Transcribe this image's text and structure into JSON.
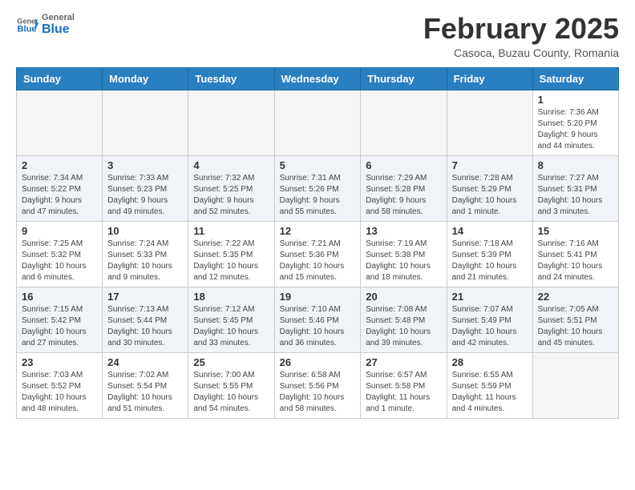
{
  "header": {
    "logo_line1": "General",
    "logo_line2": "Blue",
    "month_year": "February 2025",
    "location": "Casoca, Buzau County, Romania"
  },
  "weekdays": [
    "Sunday",
    "Monday",
    "Tuesday",
    "Wednesday",
    "Thursday",
    "Friday",
    "Saturday"
  ],
  "weeks": [
    [
      {
        "day": "",
        "info": ""
      },
      {
        "day": "",
        "info": ""
      },
      {
        "day": "",
        "info": ""
      },
      {
        "day": "",
        "info": ""
      },
      {
        "day": "",
        "info": ""
      },
      {
        "day": "",
        "info": ""
      },
      {
        "day": "1",
        "info": "Sunrise: 7:36 AM\nSunset: 5:20 PM\nDaylight: 9 hours\nand 44 minutes."
      }
    ],
    [
      {
        "day": "2",
        "info": "Sunrise: 7:34 AM\nSunset: 5:22 PM\nDaylight: 9 hours\nand 47 minutes."
      },
      {
        "day": "3",
        "info": "Sunrise: 7:33 AM\nSunset: 5:23 PM\nDaylight: 9 hours\nand 49 minutes."
      },
      {
        "day": "4",
        "info": "Sunrise: 7:32 AM\nSunset: 5:25 PM\nDaylight: 9 hours\nand 52 minutes."
      },
      {
        "day": "5",
        "info": "Sunrise: 7:31 AM\nSunset: 5:26 PM\nDaylight: 9 hours\nand 55 minutes."
      },
      {
        "day": "6",
        "info": "Sunrise: 7:29 AM\nSunset: 5:28 PM\nDaylight: 9 hours\nand 58 minutes."
      },
      {
        "day": "7",
        "info": "Sunrise: 7:28 AM\nSunset: 5:29 PM\nDaylight: 10 hours\nand 1 minute."
      },
      {
        "day": "8",
        "info": "Sunrise: 7:27 AM\nSunset: 5:31 PM\nDaylight: 10 hours\nand 3 minutes."
      }
    ],
    [
      {
        "day": "9",
        "info": "Sunrise: 7:25 AM\nSunset: 5:32 PM\nDaylight: 10 hours\nand 6 minutes."
      },
      {
        "day": "10",
        "info": "Sunrise: 7:24 AM\nSunset: 5:33 PM\nDaylight: 10 hours\nand 9 minutes."
      },
      {
        "day": "11",
        "info": "Sunrise: 7:22 AM\nSunset: 5:35 PM\nDaylight: 10 hours\nand 12 minutes."
      },
      {
        "day": "12",
        "info": "Sunrise: 7:21 AM\nSunset: 5:36 PM\nDaylight: 10 hours\nand 15 minutes."
      },
      {
        "day": "13",
        "info": "Sunrise: 7:19 AM\nSunset: 5:38 PM\nDaylight: 10 hours\nand 18 minutes."
      },
      {
        "day": "14",
        "info": "Sunrise: 7:18 AM\nSunset: 5:39 PM\nDaylight: 10 hours\nand 21 minutes."
      },
      {
        "day": "15",
        "info": "Sunrise: 7:16 AM\nSunset: 5:41 PM\nDaylight: 10 hours\nand 24 minutes."
      }
    ],
    [
      {
        "day": "16",
        "info": "Sunrise: 7:15 AM\nSunset: 5:42 PM\nDaylight: 10 hours\nand 27 minutes."
      },
      {
        "day": "17",
        "info": "Sunrise: 7:13 AM\nSunset: 5:44 PM\nDaylight: 10 hours\nand 30 minutes."
      },
      {
        "day": "18",
        "info": "Sunrise: 7:12 AM\nSunset: 5:45 PM\nDaylight: 10 hours\nand 33 minutes."
      },
      {
        "day": "19",
        "info": "Sunrise: 7:10 AM\nSunset: 5:46 PM\nDaylight: 10 hours\nand 36 minutes."
      },
      {
        "day": "20",
        "info": "Sunrise: 7:08 AM\nSunset: 5:48 PM\nDaylight: 10 hours\nand 39 minutes."
      },
      {
        "day": "21",
        "info": "Sunrise: 7:07 AM\nSunset: 5:49 PM\nDaylight: 10 hours\nand 42 minutes."
      },
      {
        "day": "22",
        "info": "Sunrise: 7:05 AM\nSunset: 5:51 PM\nDaylight: 10 hours\nand 45 minutes."
      }
    ],
    [
      {
        "day": "23",
        "info": "Sunrise: 7:03 AM\nSunset: 5:52 PM\nDaylight: 10 hours\nand 48 minutes."
      },
      {
        "day": "24",
        "info": "Sunrise: 7:02 AM\nSunset: 5:54 PM\nDaylight: 10 hours\nand 51 minutes."
      },
      {
        "day": "25",
        "info": "Sunrise: 7:00 AM\nSunset: 5:55 PM\nDaylight: 10 hours\nand 54 minutes."
      },
      {
        "day": "26",
        "info": "Sunrise: 6:58 AM\nSunset: 5:56 PM\nDaylight: 10 hours\nand 58 minutes."
      },
      {
        "day": "27",
        "info": "Sunrise: 6:57 AM\nSunset: 5:58 PM\nDaylight: 11 hours\nand 1 minute."
      },
      {
        "day": "28",
        "info": "Sunrise: 6:55 AM\nSunset: 5:59 PM\nDaylight: 11 hours\nand 4 minutes."
      },
      {
        "day": "",
        "info": ""
      }
    ]
  ]
}
